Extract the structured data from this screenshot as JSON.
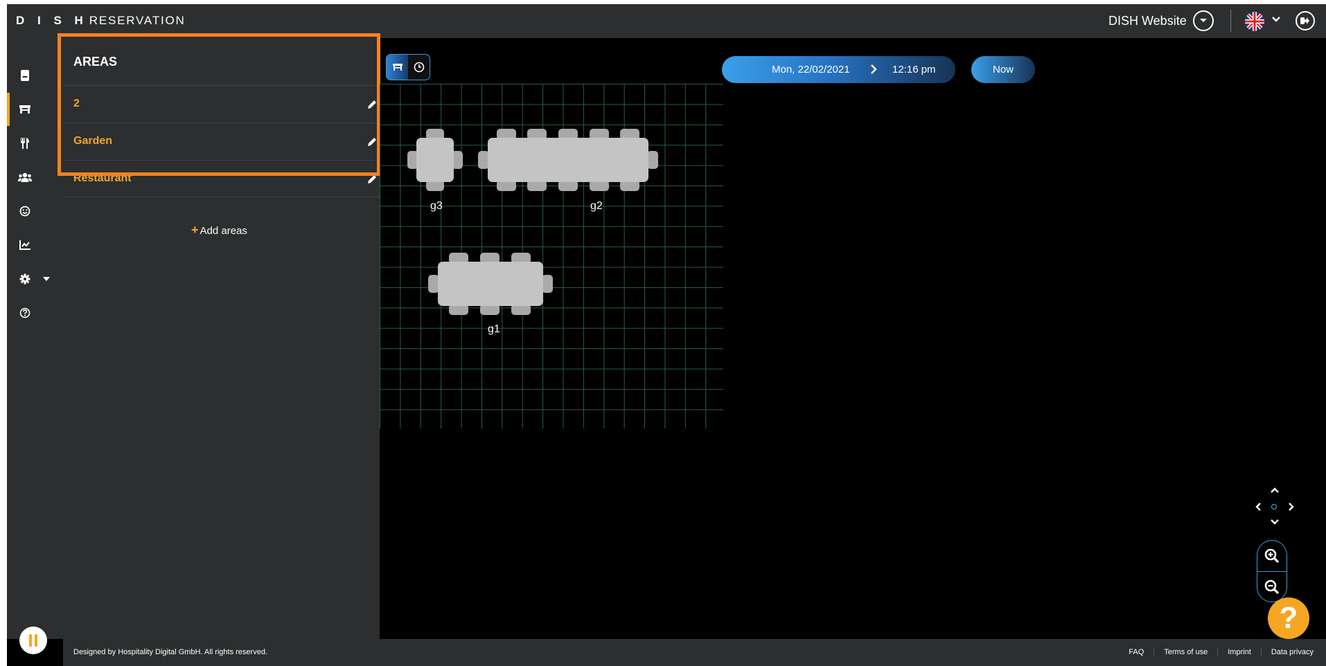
{
  "header": {
    "brand_bold": "D I S H",
    "brand_light": "RESERVATION",
    "website_label": "DISH Website",
    "language_icon": "uk-flag-icon"
  },
  "sidebar": {
    "icons": [
      "book-icon",
      "table-icon",
      "cutlery-icon",
      "guests-icon",
      "smiley-icon",
      "chart-icon",
      "gear-icon",
      "help-icon"
    ],
    "active": "table-icon"
  },
  "areas": {
    "title": "AREAS",
    "items": [
      {
        "label": "2"
      },
      {
        "label": "Garden"
      },
      {
        "label": "Restaurant"
      }
    ],
    "add_label": "Add areas"
  },
  "canvas": {
    "date": "Mon, 22/02/2021",
    "time": "12:16 pm",
    "now_label": "Now",
    "tables": [
      {
        "label": "g3",
        "seats": 4
      },
      {
        "label": "g2",
        "seats": 12
      },
      {
        "label": "g1",
        "seats": 8
      }
    ]
  },
  "help_label": "?",
  "footer": {
    "copyright": "Designed by Hospitality Digital GmbH. All rights reserved.",
    "links": [
      "FAQ",
      "Terms of use",
      "Imprint",
      "Data privacy"
    ]
  },
  "colors": {
    "accent": "#f5a623",
    "highlight": "#f5821f",
    "blue": "#3a9fea",
    "panel": "#2c2e2f"
  }
}
